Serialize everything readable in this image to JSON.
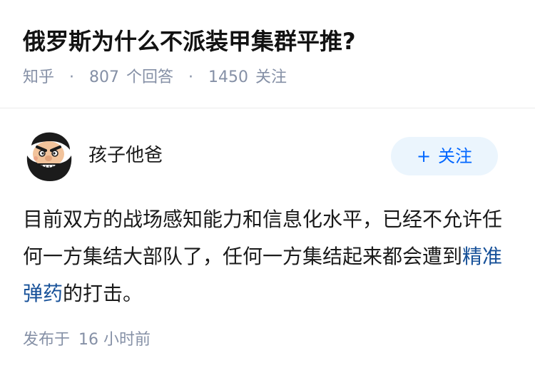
{
  "question": {
    "title": "俄罗斯为什么不派装甲集群平推?",
    "source": "知乎",
    "answer_count": "807",
    "answer_label": "个回答",
    "follower_count": "1450",
    "follower_label": "关注",
    "separator": "·"
  },
  "author": {
    "name": "孩子他爸",
    "avatar_icon": "cartoon-bearded-face-avatar",
    "follow_label": "关注",
    "follow_icon": "plus-icon",
    "follow_symbol": "+"
  },
  "answer": {
    "text_before_link": "目前双方的战场感知能力和信息化水平，已经不允许任何一方集结大部队了，任何一方集结起来都会遭到",
    "link_text": "精准弹药",
    "text_after_link": "的打击。",
    "published_label": "发布于",
    "published_time": "16 小时前"
  },
  "colors": {
    "link": "#175199",
    "accent": "#0066ff",
    "follow_button_bg": "#ebf5fd",
    "meta_text": "#8590a6"
  }
}
